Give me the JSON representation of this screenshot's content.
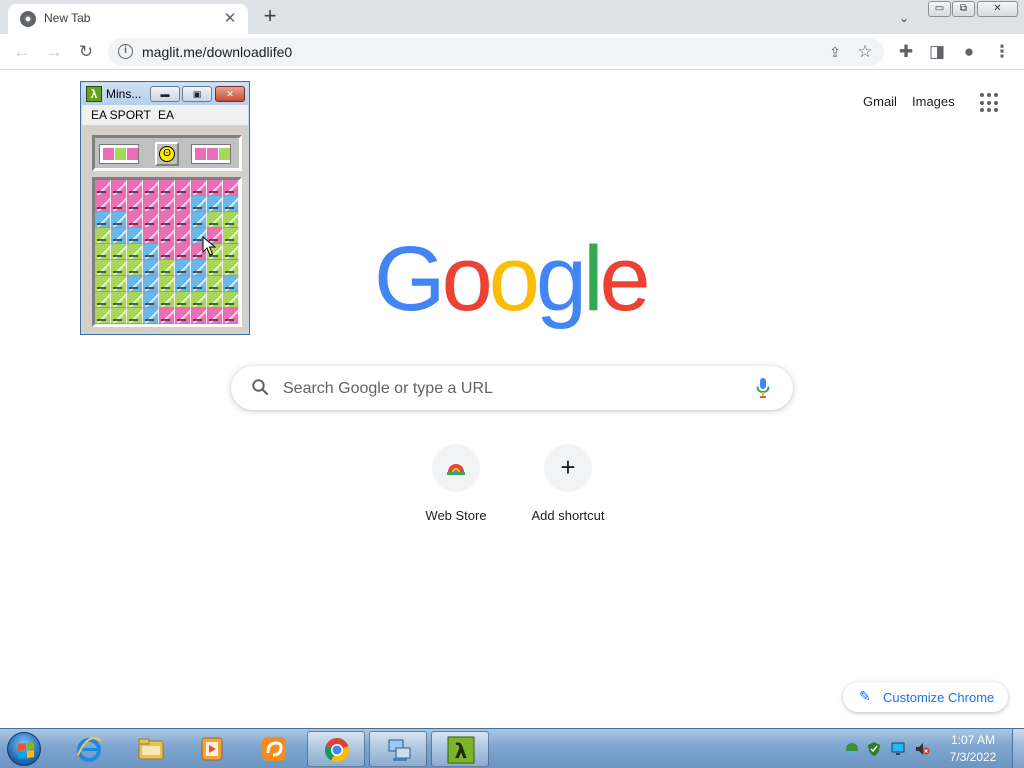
{
  "browser": {
    "tab": {
      "title": "New Tab",
      "close": "✕"
    },
    "new_tab": "+",
    "tab_search": "⌄",
    "window_controls": {
      "minimize": "▭",
      "restore": "⧉",
      "close": "✕"
    },
    "toolbar": {
      "back": "←",
      "forward": "→",
      "reload": "↻",
      "info": "i",
      "url": "maglit.me/downloadlife0",
      "share": "⇪",
      "bookmark": "☆",
      "extensions": "✚",
      "side_panel": "◨",
      "profile": "●",
      "menu": "⋮"
    }
  },
  "ntp": {
    "gmail": "Gmail",
    "images": "Images",
    "logo": [
      "G",
      "o",
      "o",
      "g",
      "l",
      "e"
    ],
    "logo_colors": [
      "#4285f4",
      "#ea4335",
      "#fbbc05",
      "#4285f4",
      "#34a853",
      "#ea4335"
    ],
    "search_placeholder": "Search Google or type a URL",
    "shortcuts": [
      {
        "label": "Web Store",
        "icon": "chrome-web-store-icon"
      },
      {
        "label": "Add shortcut",
        "icon": "plus-icon",
        "symbol": "+"
      }
    ],
    "customize": {
      "label": "Customize Chrome",
      "icon": "✎"
    }
  },
  "minesweeper": {
    "title": "Mins...",
    "app_icon": "λ",
    "buttons": {
      "minimize": "▬",
      "maximize": "▣",
      "close": "✕"
    },
    "menus": [
      "EA SPORT",
      "EA"
    ],
    "smiley": "ʘ",
    "tile_colors": [
      "#e86fb4",
      "#a7d65a",
      "#6cb7e6"
    ]
  },
  "taskbar": {
    "items": [
      "start-orb-icon",
      "internet-explorer-icon",
      "file-explorer-icon",
      "media-player-icon",
      "uc-browser-icon",
      "chrome-icon",
      "network-icon",
      "minesweeper-lambda-icon"
    ],
    "mine_glyph": "λ",
    "clock": {
      "time": "1:07 AM",
      "date": "7/3/2022"
    }
  }
}
